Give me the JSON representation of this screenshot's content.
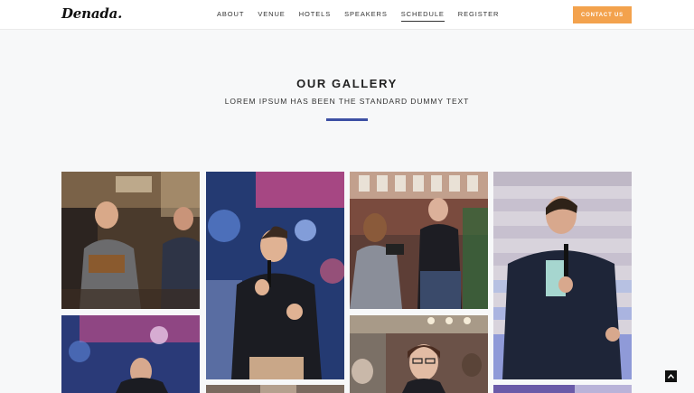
{
  "header": {
    "logo": "Denada.",
    "nav": [
      "ABOUT",
      "VENUE",
      "HOTELS",
      "SPEAKERS",
      "SCHEDULE",
      "REGISTER"
    ],
    "active_nav": "SCHEDULE",
    "contact_label": "CONTACT US"
  },
  "gallery": {
    "title": "OUR GALLERY",
    "subtitle": "LOREM IPSUM HAS BEEN THE STANDARD DUMMY TEXT"
  },
  "colors": {
    "accent": "#3d50a4",
    "contact_button": "#f3a24d",
    "background": "#f7f8f9"
  },
  "icons": {
    "scroll_top": "chevron-up-icon"
  }
}
